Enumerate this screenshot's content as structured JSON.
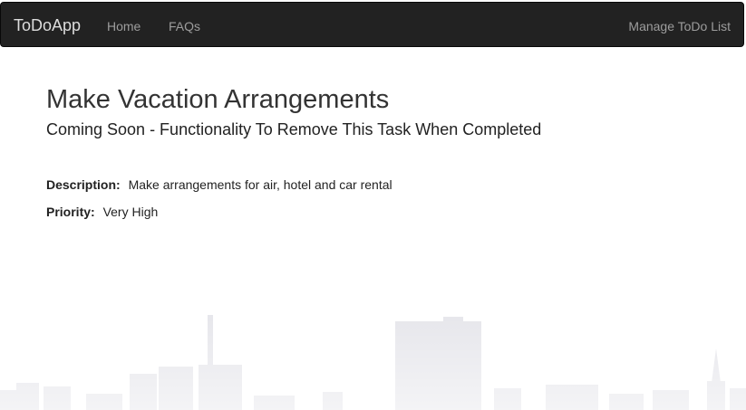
{
  "navbar": {
    "brand": "ToDoApp",
    "links": [
      {
        "label": "Home"
      },
      {
        "label": "FAQs"
      }
    ],
    "right_link": "Manage ToDo List",
    "background": "#222222"
  },
  "task": {
    "title": "Make Vacation Arrangements",
    "subtitle": "Coming Soon - Functionality To Remove This Task When Completed",
    "description_label": "Description:",
    "description": "Make arrangements for air, hotel and car rental",
    "priority_label": "Priority:",
    "priority": "Very High"
  },
  "background_art": {
    "type": "city-skyline-silhouette",
    "color": "#e3e3e8"
  }
}
